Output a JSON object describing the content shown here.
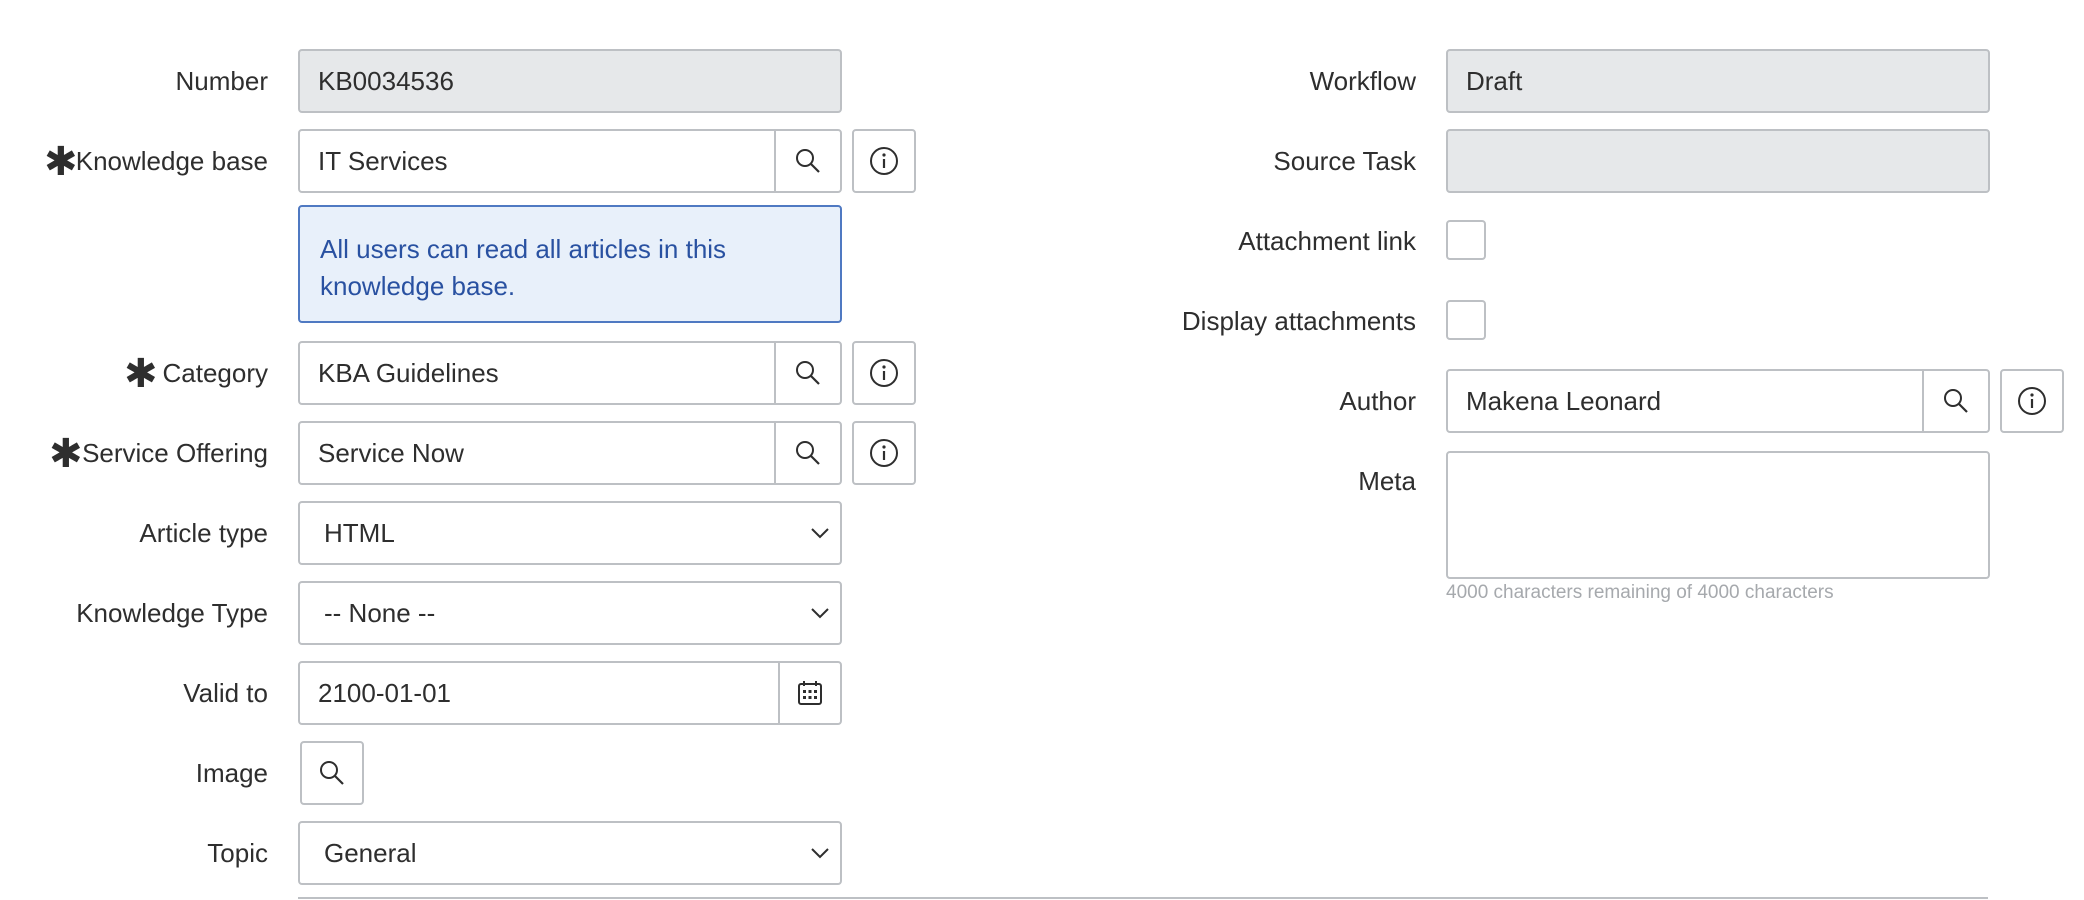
{
  "form": {
    "left": {
      "number": {
        "label": "Number",
        "value": "KB0034536"
      },
      "knowledge_base": {
        "label": "Knowledge base",
        "value": "IT Services",
        "required": true
      },
      "kb_notice": "All users can read all articles in this knowledge base.",
      "category": {
        "label": "Category",
        "value": "KBA Guidelines",
        "required": true
      },
      "service_offering": {
        "label": "Service Offering",
        "value": "Service Now",
        "required": true
      },
      "article_type": {
        "label": "Article type",
        "value": "HTML"
      },
      "knowledge_type": {
        "label": "Knowledge Type",
        "value": "-- None --"
      },
      "valid_to": {
        "label": "Valid to",
        "value": "2100-01-01"
      },
      "image": {
        "label": "Image"
      },
      "topic": {
        "label": "Topic",
        "value": "General"
      }
    },
    "right": {
      "workflow": {
        "label": "Workflow",
        "value": "Draft"
      },
      "source_task": {
        "label": "Source Task",
        "value": ""
      },
      "attachment_link": {
        "label": "Attachment link",
        "checked": false
      },
      "display_attachments": {
        "label": "Display attachments",
        "checked": false
      },
      "author": {
        "label": "Author",
        "value": "Makena Leonard"
      },
      "meta": {
        "label": "Meta",
        "value": "",
        "hint": "4000 characters remaining of 4000 characters"
      }
    }
  },
  "icons": {
    "required": "asterisk-icon",
    "lookup": "search-icon",
    "info": "info-icon",
    "calendar": "calendar-icon",
    "dropdown": "chevron-down-icon"
  },
  "colors": {
    "readonly_bg": "#e6e8ea",
    "border": "#bdc0c4",
    "notice_bg": "#e8f0fa",
    "notice_border": "#4f79c2",
    "notice_text": "#2951a1"
  }
}
